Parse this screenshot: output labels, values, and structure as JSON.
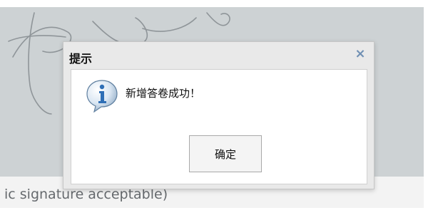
{
  "dialog": {
    "title": "提示",
    "close_glyph": "×",
    "icon": "info-icon",
    "message": "新增答卷成功！",
    "ok_label": "确定"
  },
  "background": {
    "hint_text": "ic signature acceptable)"
  },
  "colors": {
    "signature_area": "#cdd2d4",
    "close_icon": "#6f8fb3",
    "info_icon": "#2f6fb6"
  }
}
